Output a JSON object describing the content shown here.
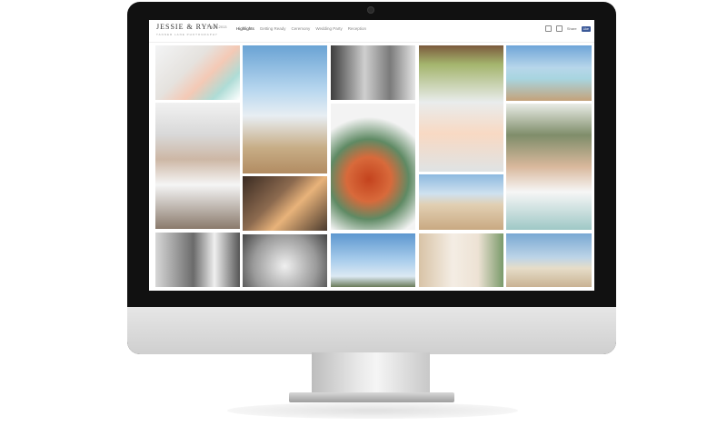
{
  "site": {
    "title": "JESSIE & RYAN",
    "date": "5.11.2013",
    "subtitle": "TANNER LANE PHOTOGRAPHY"
  },
  "nav": [
    "Highlights",
    "Getting Ready",
    "Ceremony",
    "Wedding Party",
    "Reception"
  ],
  "tools": {
    "share_label": "Share",
    "like_label": "Like"
  }
}
